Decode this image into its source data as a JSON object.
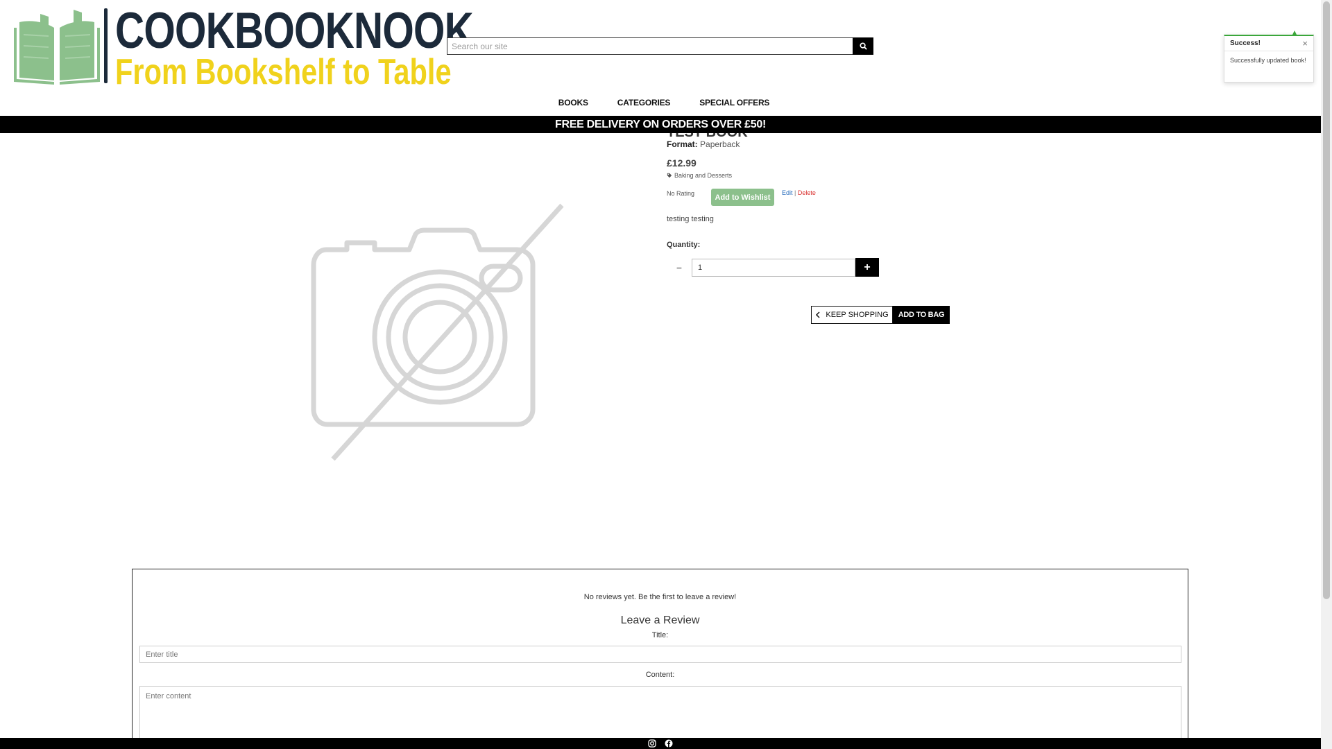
{
  "brand": {
    "name": "COOKBOOKNOOK",
    "tagline": "From Bookshelf to Table",
    "colors": {
      "title": "#1c2a3a",
      "tagline": "#f0d21c",
      "book_icon": "#8cc08c"
    }
  },
  "search": {
    "placeholder": "Search our site",
    "icon": "search-icon"
  },
  "nav": {
    "books": "BOOKS",
    "categories": "CATEGORIES",
    "special_offers": "SPECIAL OFFERS"
  },
  "banner": {
    "text": "FREE DELIVERY ON ORDERS OVER £50!"
  },
  "toast": {
    "title": "Success!",
    "close": "×",
    "message": "Successfully updated book!",
    "accent": "#3aa63a"
  },
  "product": {
    "title_partial": "TEST BOOK",
    "format_label": "Format:",
    "format_value": "Paperback",
    "price": "£12.99",
    "category": "Baking and Desserts",
    "rating": "No Rating",
    "wishlist_label": "Add to Wishlist",
    "edit_label": "Edit",
    "separator": "|",
    "delete_label": "Delete",
    "description": "testing testing",
    "image_icon": "no-image-camera-icon"
  },
  "quantity": {
    "label": "Quantity:",
    "value": "1",
    "minus": "−",
    "plus": "+"
  },
  "actions": {
    "keep_shopping": "KEEP SHOPPING",
    "add_to_bag": "ADD TO BAG"
  },
  "reviews": {
    "empty_message": "No reviews yet. Be the first to leave a review!",
    "heading": "Leave a Review",
    "title_label": "Title:",
    "title_placeholder": "Enter title",
    "content_label": "Content:",
    "content_placeholder": "Enter content"
  },
  "footer": {
    "icons": [
      "instagram-icon",
      "facebook-icon"
    ]
  }
}
